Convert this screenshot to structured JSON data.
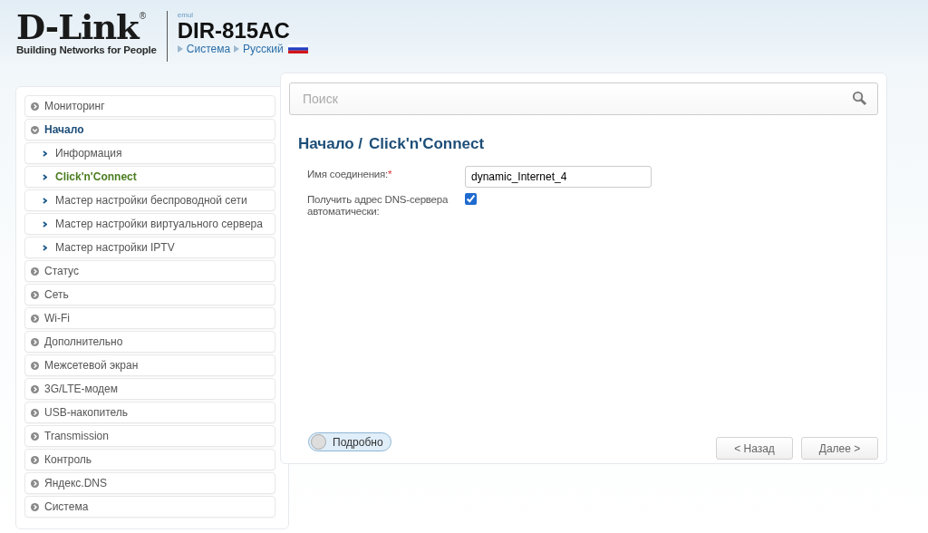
{
  "header": {
    "logo": {
      "brand": "D-Link",
      "registered": "®",
      "tagline": "Building Networks for People"
    },
    "emul": "emul",
    "model": "DIR-815AC",
    "breadcrumbs": [
      "Система",
      "Русский"
    ]
  },
  "sidebar": {
    "items": [
      {
        "label": "Мониторинг",
        "expanded": false,
        "selected": false
      },
      {
        "label": "Начало",
        "expanded": true,
        "selected": false,
        "children": [
          {
            "label": "Информация",
            "selected": false
          },
          {
            "label": "Click'n'Connect",
            "selected": true
          },
          {
            "label": "Мастер настройки беспроводной сети",
            "selected": false
          },
          {
            "label": "Мастер настройки виртуального сервера",
            "selected": false
          },
          {
            "label": "Мастер настройки IPTV",
            "selected": false
          }
        ]
      },
      {
        "label": "Статус",
        "expanded": false,
        "selected": false
      },
      {
        "label": "Сеть",
        "expanded": false,
        "selected": false
      },
      {
        "label": "Wi-Fi",
        "expanded": false,
        "selected": false
      },
      {
        "label": "Дополнительно",
        "expanded": false,
        "selected": false
      },
      {
        "label": "Межсетевой экран",
        "expanded": false,
        "selected": false
      },
      {
        "label": "3G/LTE-модем",
        "expanded": false,
        "selected": false
      },
      {
        "label": "USB-накопитель",
        "expanded": false,
        "selected": false
      },
      {
        "label": "Transmission",
        "expanded": false,
        "selected": false
      },
      {
        "label": "Контроль",
        "expanded": false,
        "selected": false
      },
      {
        "label": "Яндекс.DNS",
        "expanded": false,
        "selected": false
      },
      {
        "label": "Система",
        "expanded": false,
        "selected": false
      }
    ]
  },
  "search": {
    "placeholder": "Поиск"
  },
  "page_title": [
    "Начало /",
    "Click'n'Connect"
  ],
  "form": {
    "fields": [
      {
        "kind": "text",
        "label": "Имя соединения:",
        "required_mark": "*",
        "value": "dynamic_Internet_4"
      },
      {
        "kind": "checkbox",
        "label": "Получить адрес DNS-сервера автоматически:",
        "checked": true
      }
    ]
  },
  "details_toggle": {
    "label": "Подробно",
    "on": false
  },
  "buttons": [
    "< Назад",
    "Далее >"
  ]
}
